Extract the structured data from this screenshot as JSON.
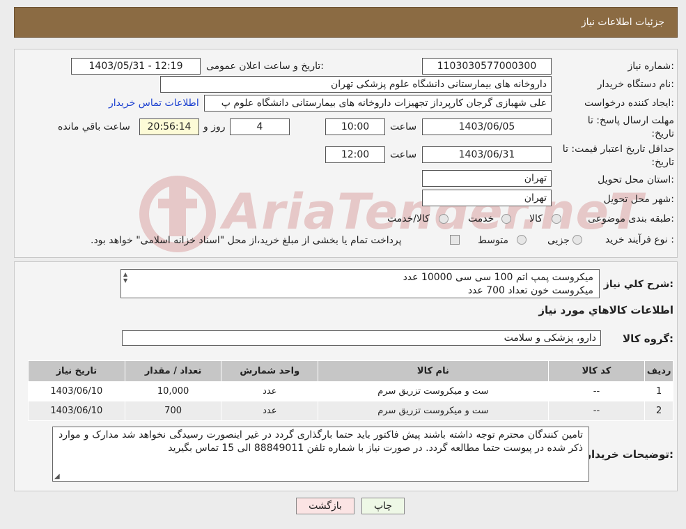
{
  "header": {
    "title": "جزئیات اطلاعات نیاز"
  },
  "fields": {
    "need_number_label": "شماره نیاز:",
    "need_number": "1103030577000300",
    "announce_label": "تاریخ و ساعت اعلان عمومی:",
    "announce_value": "1403/05/31 - 12:19",
    "buyer_org_label": "نام دستگاه خریدار:",
    "buyer_org": "داروخانه های بیمارستانی دانشگاه علوم پزشکی تهران",
    "creator_label": "ایجاد کننده درخواست:",
    "creator": "علی شهبازی گرجان کارپرداز تجهیزات داروخانه های بیمارستانی دانشگاه علوم پ",
    "contact_link": "اطلاعات تماس خریدار",
    "reply_deadline_label": "مهلت ارسال پاسخ: تا تاریخ:",
    "reply_date": "1403/06/05",
    "time_label": "ساعت",
    "reply_time": "10:00",
    "days": "4",
    "days_label": "روز و",
    "remaining": "20:56:14",
    "remaining_label": "ساعت باقي مانده",
    "price_valid_label": "حداقل تاریخ اعتبار قیمت: تا تاریخ:",
    "price_date": "1403/06/31",
    "price_time": "12:00",
    "province_label": "استان محل تحویل:",
    "province": "تهران",
    "city_label": "شهر محل تحویل:",
    "city": "تهران",
    "category_label": "طبقه بندی موضوعی:",
    "category_options": [
      "کالا",
      "خدمت",
      "کالا/خدمت"
    ],
    "process_label": "نوع فرآیند خرید :",
    "process_options": [
      "جزیی",
      "متوسط"
    ],
    "process_note": "پرداخت تمام یا بخشی از مبلغ خرید،از محل \"اسناد خزانه اسلامی\" خواهد بود."
  },
  "description": {
    "label": "شرح کلي نياز:",
    "lines": [
      "میکروست پمپ اتم 100 سی سی 10000 عدد",
      "میکروست خون تعداد 700 عدد"
    ]
  },
  "goods": {
    "section_title": "اطلاعات کالاهاي مورد نياز",
    "group_label": "گروه کالا:",
    "group_value": "دارو، پزشکی و سلامت",
    "columns": [
      "رديف",
      "کد کالا",
      "نام کالا",
      "واحد شمارش",
      "تعداد / مقدار",
      "تاریخ نیاز"
    ],
    "rows": [
      [
        "1",
        "--",
        "ست و میکروست تزریق سرم",
        "عدد",
        "10,000",
        "1403/06/10"
      ],
      [
        "2",
        "--",
        "ست و میکروست تزریق سرم",
        "عدد",
        "700",
        "1403/06/10"
      ]
    ]
  },
  "buyer_notes": {
    "label": "توضیحات خریدار:",
    "text": "تامین کنندگان محترم توجه داشته باشند پیش فاکتور باید حتما بارگذاری گردد در غیر اینصورت رسیدگی نخواهد شد مدارک و موارد ذکر شده در پیوست حتما مطالعه گردد. در صورت نیاز با شماره تلفن 88849011 الی 15 تماس بگیرید"
  },
  "buttons": {
    "print": "چاپ",
    "back": "بازگشت"
  },
  "watermark": "AriaTender.neT"
}
